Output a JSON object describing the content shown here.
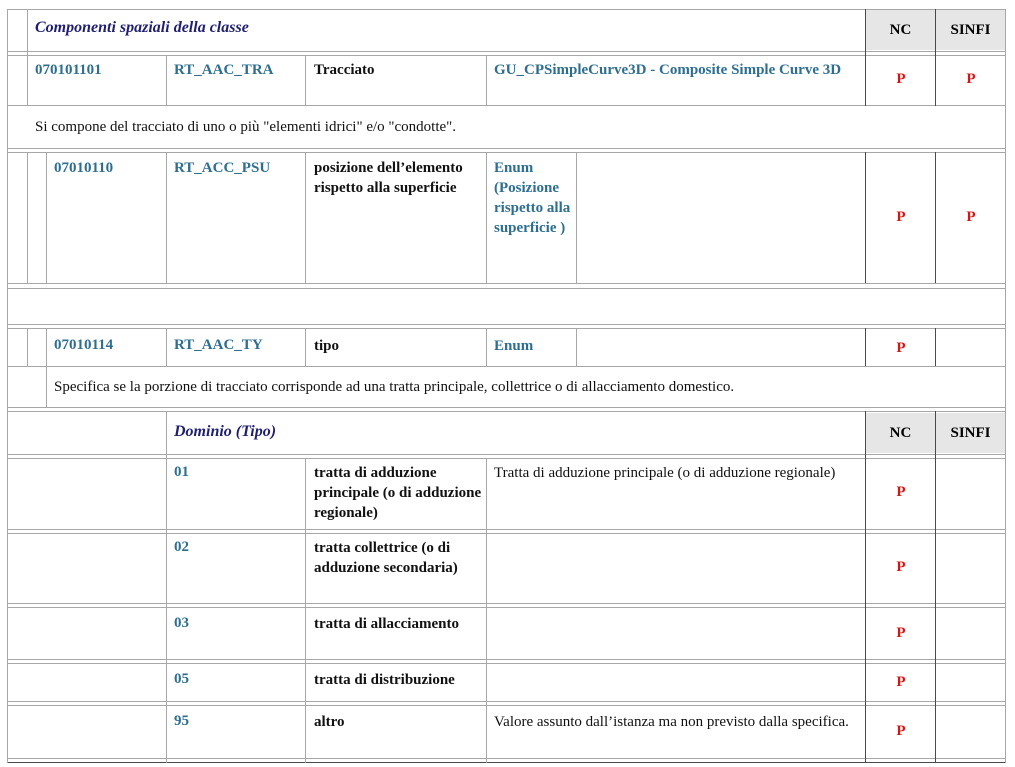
{
  "section_title": "Componenti spaziali della classe",
  "headers": {
    "nc": "NC",
    "sinfi": "SINFI"
  },
  "main_attr": {
    "code": "070101101",
    "id": "RT_AAC_TRA",
    "name": "Tracciato",
    "type": "GU_CPSimpleCurve3D - Composite Simple Curve 3D",
    "nc": "P",
    "sinfi": "P"
  },
  "main_desc": "Si compone del tracciato di uno o più \"elementi idrici\" e/o \"condotte\".",
  "psu": {
    "code": "07010110",
    "id": "RT_ACC_PSU",
    "name": "posizione dell’elemento rispetto alla superficie",
    "type": "Enum (Posizione rispetto alla superficie )",
    "nc": "P",
    "sinfi": "P"
  },
  "ty": {
    "code": "07010114",
    "id": "RT_AAC_TY",
    "name": "tipo",
    "type": "Enum",
    "nc": "P",
    "sinfi": ""
  },
  "ty_desc": "Specifica se la porzione di tracciato corrisponde ad una tratta principale, collettrice o di allacciamento domestico.",
  "domain_title": "Dominio (Tipo)",
  "domain": [
    {
      "code": "01",
      "name": "tratta di adduzione principale (o di adduzione regionale)",
      "desc": "Tratta di adduzione principale (o di adduzione regionale)",
      "nc": "P",
      "sinfi": ""
    },
    {
      "code": "02",
      "name": "tratta collettrice (o di adduzione secondaria)",
      "desc": "",
      "nc": "P",
      "sinfi": ""
    },
    {
      "code": "03",
      "name": "tratta di allacciamento",
      "desc": "",
      "nc": "P",
      "sinfi": ""
    },
    {
      "code": "05",
      "name": "tratta di distribuzione",
      "desc": "",
      "nc": "P",
      "sinfi": ""
    },
    {
      "code": "95",
      "name": "altro",
      "desc": "Valore assunto dall’istanza ma non previsto dalla specifica.",
      "nc": "P",
      "sinfi": ""
    }
  ]
}
